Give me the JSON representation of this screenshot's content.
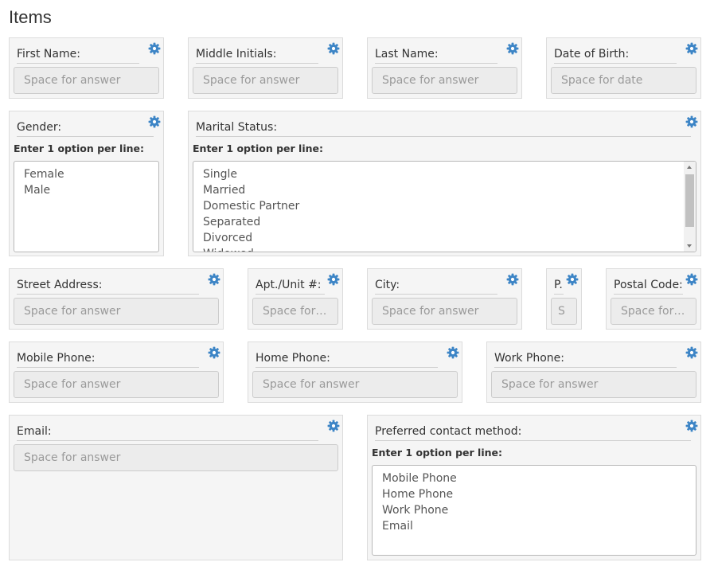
{
  "page": {
    "title": "Items"
  },
  "colors": {
    "gear": "#3d85c6",
    "card_bg": "#f5f5f5",
    "field_bg": "#ececec"
  },
  "hint_text": "Enter 1 option per line:",
  "fields": {
    "first_name": {
      "label": "First Name:",
      "placeholder": "Space for answer"
    },
    "middle": {
      "label": "Middle Initials:",
      "placeholder": "Space for answer"
    },
    "last_name": {
      "label": "Last Name:",
      "placeholder": "Space for answer"
    },
    "dob": {
      "label": "Date of Birth:",
      "placeholder": "Space for date"
    },
    "gender": {
      "label": "Gender:",
      "options": [
        "Female",
        "Male"
      ]
    },
    "marital": {
      "label": "Marital Status:",
      "options": [
        "Single",
        "Married",
        "Domestic Partner",
        "Separated",
        "Divorced",
        "Widowed"
      ]
    },
    "street": {
      "label": "Street Address:",
      "placeholder": "Space for answer"
    },
    "apt": {
      "label": "Apt./Unit #:",
      "placeholder": "Space for ..."
    },
    "city": {
      "label": "City:",
      "placeholder": "Space for answer"
    },
    "province": {
      "label": "P...",
      "placeholder": "S"
    },
    "postal": {
      "label": "Postal Code:",
      "placeholder": "Space for ..."
    },
    "mobile": {
      "label": "Mobile Phone:",
      "placeholder": "Space for answer"
    },
    "home": {
      "label": "Home Phone:",
      "placeholder": "Space for answer"
    },
    "work": {
      "label": "Work Phone:",
      "placeholder": "Space for answer"
    },
    "email": {
      "label": "Email:",
      "placeholder": "Space for answer"
    },
    "contact": {
      "label": "Preferred contact method:",
      "options": [
        "Mobile Phone",
        "Home Phone",
        "Work Phone",
        "Email"
      ]
    }
  }
}
